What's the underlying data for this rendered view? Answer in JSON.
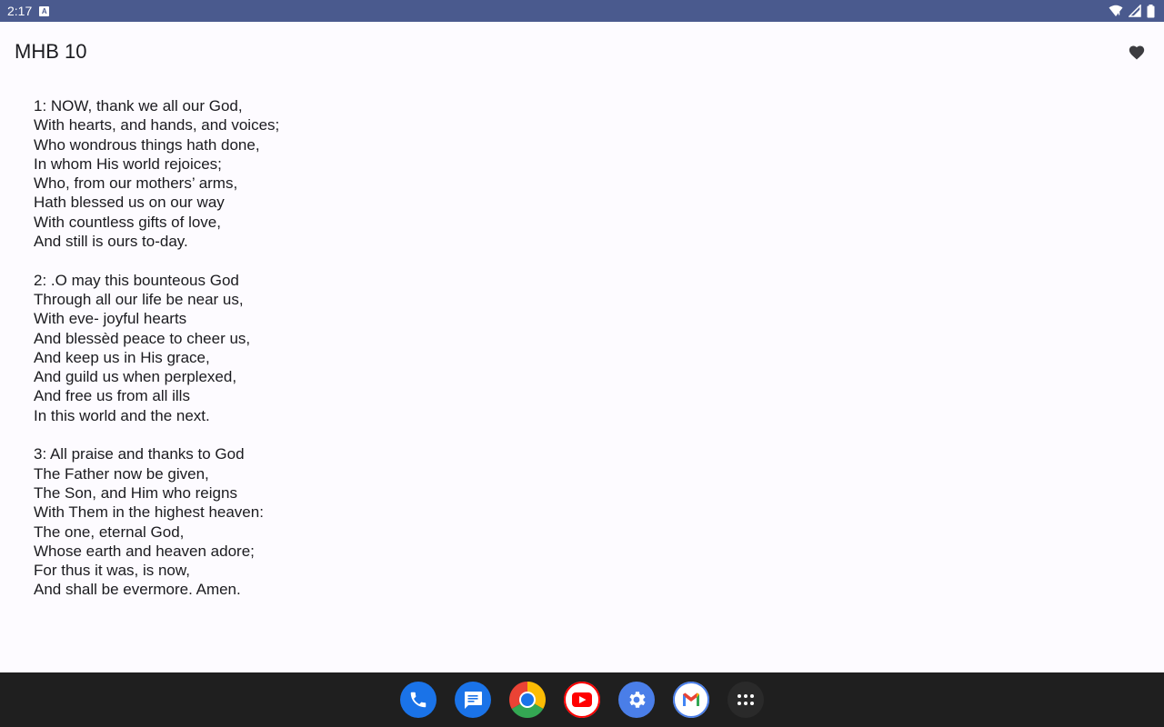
{
  "status_bar": {
    "time": "2:17",
    "notification_badge": "A",
    "icons": [
      "wifi-icon",
      "cellular-signal-icon",
      "battery-icon"
    ]
  },
  "header": {
    "title": "MHB 10",
    "favorite_icon": "heart-icon"
  },
  "hymn": {
    "verses": [
      {
        "lines": [
          "1: NOW, thank we all our God,",
          "With hearts, and hands, and voices;",
          "Who wondrous things hath done,",
          "In whom His world rejoices;",
          "Who, from our mothers’ arms,",
          "Hath blessed us on our way",
          "With countless gifts of love,",
          "And still is ours to-day."
        ]
      },
      {
        "lines": [
          "2: .O may this bounteous God",
          "Through all our life be near us,",
          "With eve- joyful hearts",
          "And blessèd peace to cheer us,",
          "And keep us in His grace,",
          "And guild us when perplexed,",
          "And free us from all ills",
          "In this world and the next."
        ]
      },
      {
        "lines": [
          "3: All praise and thanks to God",
          "The Father now be given,",
          "The Son, and Him who reigns",
          "With Them in the highest heaven:",
          "The one, eternal God,",
          "Whose earth and heaven adore;",
          "For thus it was, is now,",
          "And shall be evermore. Amen."
        ]
      }
    ]
  },
  "dock": {
    "apps": [
      "phone-app",
      "messages-app",
      "chrome-app",
      "youtube-app",
      "settings-app",
      "gmail-app",
      "all-apps"
    ]
  },
  "colors": {
    "status_bar": "#4a5a8e",
    "background": "#fdfbff",
    "text": "#1b1b1f",
    "nav_bar": "#1f1f1f"
  }
}
